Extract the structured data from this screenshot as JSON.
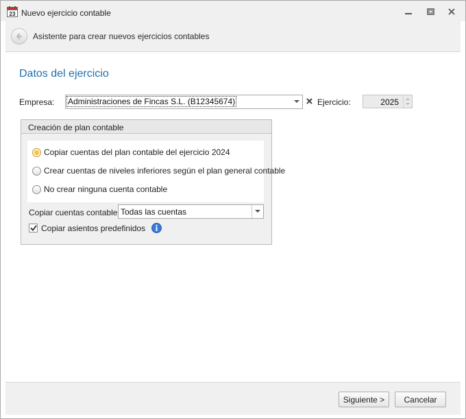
{
  "window": {
    "title": "Nuevo ejercicio contable",
    "icon": "calendar-23-icon"
  },
  "header": {
    "subtitle": "Asistente para crear nuevos ejercicios contables",
    "back_icon": "back-arrow-icon"
  },
  "main": {
    "section_title": "Datos del ejercicio",
    "empresa": {
      "label": "Empresa:",
      "value": "Administraciones de Fincas S.L. (B12345674)"
    },
    "ejercicio": {
      "label": "Ejercicio:",
      "value": "2025"
    },
    "group": {
      "title": "Creación de plan contable",
      "options": [
        {
          "label": "Copiar cuentas del plan contable del ejercicio 2024",
          "checked": true
        },
        {
          "label": "Crear cuentas de niveles inferiores según el plan general contable",
          "checked": false
        },
        {
          "label": "No crear ninguna cuenta contable",
          "checked": false
        }
      ],
      "copiar_cuentas": {
        "label": "Copiar cuentas contables:",
        "value": "Todas las cuentas"
      },
      "copiar_asientos": {
        "label": "Copiar asientos predefinidos",
        "checked": true
      }
    }
  },
  "footer": {
    "next_label": "Siguiente >",
    "cancel_label": "Cancelar"
  },
  "colors": {
    "accent": "#1f6fad",
    "radio_selected": "#f6c343",
    "info": "#3b78d8"
  }
}
